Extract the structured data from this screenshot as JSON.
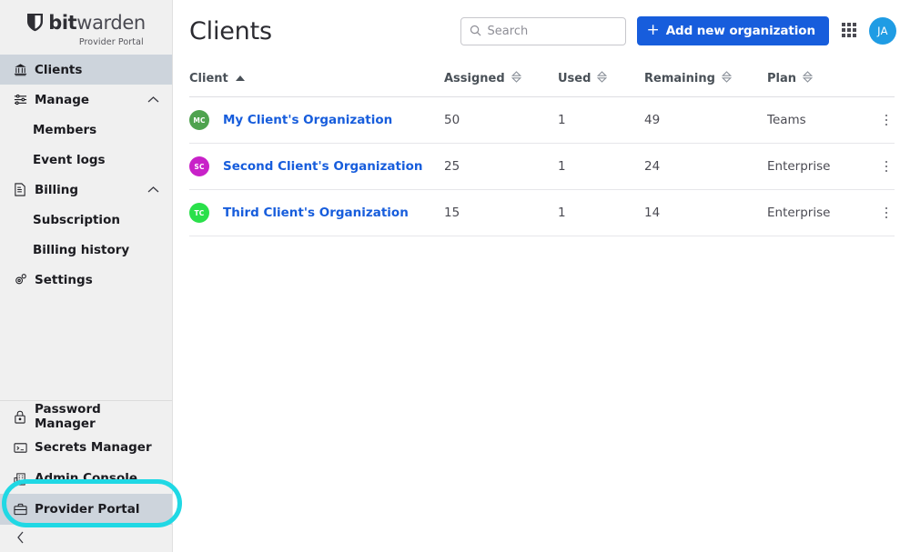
{
  "brand": {
    "name_bold": "bit",
    "name_light": "warden",
    "subtitle": "Provider Portal",
    "shield_icon": "shield-icon"
  },
  "sidebar": {
    "primary_items": [
      {
        "label": "Clients",
        "icon": "bank-icon",
        "active": true,
        "type": "item"
      },
      {
        "label": "Manage",
        "icon": "sliders-icon",
        "active": false,
        "type": "group",
        "chevron": "chevron-up-icon"
      },
      {
        "label": "Members",
        "type": "sub"
      },
      {
        "label": "Event logs",
        "type": "sub"
      },
      {
        "label": "Billing",
        "icon": "invoice-icon",
        "active": false,
        "type": "group",
        "chevron": "chevron-up-icon"
      },
      {
        "label": "Subscription",
        "type": "sub"
      },
      {
        "label": "Billing history",
        "type": "sub"
      },
      {
        "label": "Settings",
        "icon": "gears-icon",
        "active": false,
        "type": "item"
      }
    ],
    "product_items": [
      {
        "label": "Password Manager",
        "icon": "lock-icon",
        "active": false
      },
      {
        "label": "Secrets Manager",
        "icon": "terminal-icon",
        "active": false
      },
      {
        "label": "Admin Console",
        "icon": "building-icon",
        "active": false
      },
      {
        "label": "Provider Portal",
        "icon": "briefcase-icon",
        "active": true
      }
    ],
    "collapse_icon": "chevron-left-icon",
    "highlight_color": "#20d8e4",
    "highlighted_item": "Provider Portal"
  },
  "header": {
    "title": "Clients",
    "search": {
      "placeholder": "Search",
      "value": "",
      "icon": "search-icon"
    },
    "add_button": {
      "label": "Add new organization",
      "icon": "plus-icon",
      "color": "#175ddc"
    },
    "apps_icon": "grid-apps-icon",
    "avatar": {
      "initials": "JA",
      "color": "#1f9ce4"
    }
  },
  "table": {
    "columns": [
      {
        "key": "client",
        "label": "Client",
        "sort": "asc",
        "sort_icon": "sort-asc-icon"
      },
      {
        "key": "assigned",
        "label": "Assigned",
        "sort": "none",
        "sort_icon": "sort-icon"
      },
      {
        "key": "used",
        "label": "Used",
        "sort": "none",
        "sort_icon": "sort-icon"
      },
      {
        "key": "remaining",
        "label": "Remaining",
        "sort": "none",
        "sort_icon": "sort-icon"
      },
      {
        "key": "plan",
        "label": "Plan",
        "sort": "none",
        "sort_icon": "sort-icon"
      }
    ],
    "rows": [
      {
        "avatar_initials": "MC",
        "avatar_color": "#4fa34f",
        "client": "My Client's Organization",
        "assigned": "50",
        "used": "1",
        "remaining": "49",
        "plan": "Teams",
        "menu_icon": "kebab-menu-icon"
      },
      {
        "avatar_initials": "SC",
        "avatar_color": "#c821c8",
        "client": "Second Client's Organization",
        "assigned": "25",
        "used": "1",
        "remaining": "24",
        "plan": "Enterprise",
        "menu_icon": "kebab-menu-icon"
      },
      {
        "avatar_initials": "TC",
        "avatar_color": "#2ae04a",
        "client": "Third Client's Organization",
        "assigned": "15",
        "used": "1",
        "remaining": "14",
        "plan": "Enterprise",
        "menu_icon": "kebab-menu-icon"
      }
    ]
  }
}
